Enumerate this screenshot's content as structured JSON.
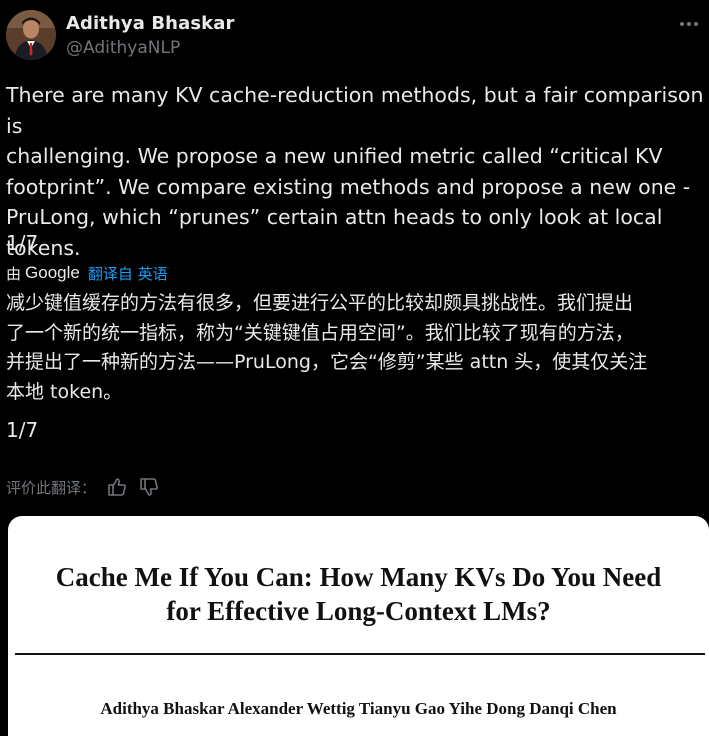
{
  "author": {
    "name": "Adithya Bhaskar",
    "handle": "@AdithyaNLP"
  },
  "tweet": {
    "text": "There are many KV cache-reduction methods, but a fair comparison is\nchallenging. We propose a new unified metric called “critical KV\nfootprint”. We compare existing methods and propose a new one -\nPruLong, which “prunes” certain attn heads to only look at local tokens.",
    "counter": "1/7"
  },
  "translation": {
    "by_label": "由",
    "provider": "Google",
    "link_label": "翻译自 英语",
    "text": "减少键值缓存的方法有很多，但要进行公平的比较却颇具挑战性。我们提出\n了一个新的统一指标，称为“关键键值占用空间”。我们比较了现有的方法，\n并提出了一种新的方法——PruLong，它会“修剪”某些 attn 头，使其仅关注\n本地 token。",
    "counter": "1/7",
    "rate_label": "评价此翻译："
  },
  "icons": {
    "more": "more-horizontal-icon",
    "thumb_up": "thumbs-up-icon",
    "thumb_down": "thumbs-down-icon"
  },
  "paper": {
    "title": "Cache Me If You Can: How Many KVs Do You Need\nfor Effective Long-Context LMs?",
    "authors": "Adithya Bhaskar  Alexander Wettig  Tianyu Gao  Yihe Dong  Danqi Chen"
  },
  "colors": {
    "background": "#000000",
    "text": "#e7e9ea",
    "secondary_text": "#71767b",
    "link": "#1d9bf0",
    "card": "#ffffff"
  }
}
